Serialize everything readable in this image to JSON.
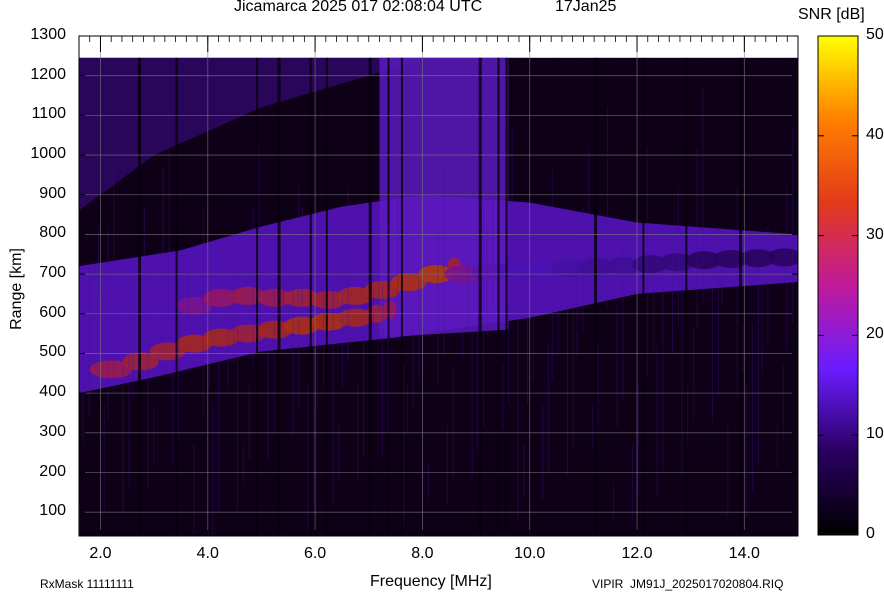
{
  "title": "Jicamarca 2025 017 02:08:04 UTC",
  "date": "17Jan25",
  "colorbar": {
    "label": "SNR [dB]",
    "range": [
      0,
      50
    ],
    "ticks": [
      "0",
      "10",
      "20",
      "30",
      "40",
      "50"
    ],
    "stops": [
      "#000000",
      "#2a0060",
      "#6a1cff",
      "#c01a9a",
      "#e33a1a",
      "#ff8000",
      "#ffff00"
    ]
  },
  "footer": {
    "rxmask": "RxMask 11111111",
    "file": "VIPIR  JM91J_2025017020804.RIQ"
  },
  "chart_data": {
    "type": "heatmap",
    "title": "Jicamarca 2025 017 02:08:04 UTC",
    "xlabel": "Frequency [MHz]",
    "ylabel": "Range [km]",
    "xlim": [
      1.6,
      15.0
    ],
    "ylim": [
      40,
      1300
    ],
    "xticks": [
      "2.0",
      "4.0",
      "6.0",
      "8.0",
      "10.0",
      "12.0",
      "14.0"
    ],
    "yticks": [
      "100",
      "200",
      "300",
      "400",
      "500",
      "600",
      "700",
      "800",
      "900",
      "1000",
      "1100",
      "1200",
      "1300"
    ],
    "colorbar_label": "SNR [dB]",
    "zlim": [
      0,
      50
    ],
    "grid": true,
    "traces": [
      {
        "x": [
          1.9,
          2.5,
          3.0,
          3.5,
          4.0,
          4.5,
          5.0,
          5.5,
          6.0,
          6.5,
          7.0,
          7.3
        ],
        "y": [
          460,
          480,
          505,
          525,
          540,
          550,
          560,
          570,
          580,
          590,
          600,
          610
        ],
        "snr": [
          28,
          30,
          30,
          32,
          32,
          30,
          32,
          34,
          34,
          32,
          30,
          28
        ]
      },
      {
        "x": [
          3.5,
          4.0,
          4.5,
          5.0,
          5.5,
          6.0,
          6.5,
          7.0,
          7.5,
          8.0,
          8.5
        ],
        "y": [
          620,
          640,
          645,
          640,
          640,
          635,
          645,
          660,
          680,
          700,
          720
        ],
        "snr": [
          22,
          26,
          28,
          28,
          30,
          30,
          32,
          32,
          34,
          36,
          30
        ]
      },
      {
        "x": [
          8.5,
          9.0,
          9.5,
          10.0,
          10.5,
          11.0,
          11.5,
          12.0,
          12.5,
          13.0,
          13.5,
          14.0,
          14.5,
          15.0
        ],
        "y": [
          700,
          705,
          710,
          712,
          715,
          718,
          720,
          725,
          730,
          735,
          738,
          740,
          742,
          745
        ],
        "snr": [
          22,
          18,
          16,
          16,
          15,
          14,
          14,
          12,
          12,
          10,
          10,
          10,
          10,
          10
        ]
      }
    ]
  }
}
